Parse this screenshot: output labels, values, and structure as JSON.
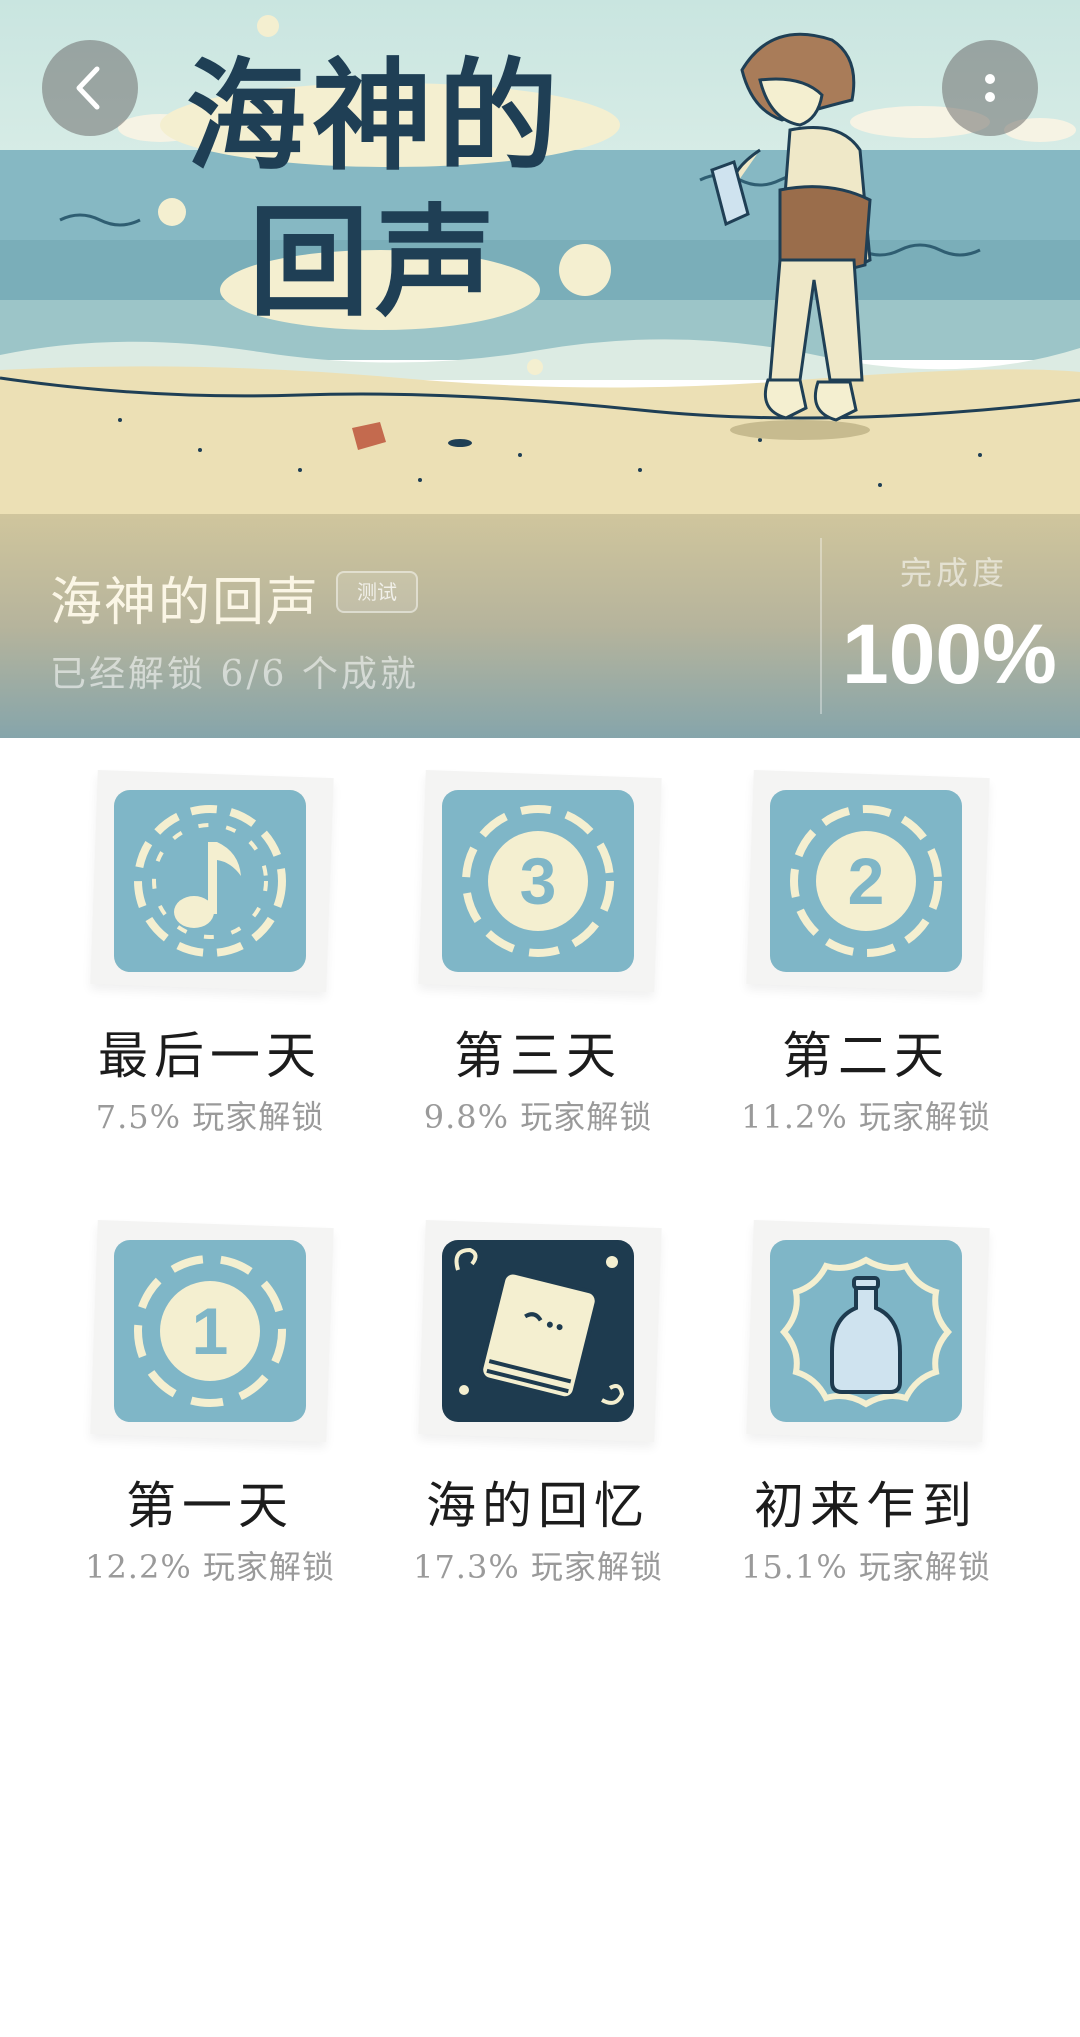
{
  "hero": {
    "title_art_line1": "海神的",
    "title_art_line2": "回声",
    "game_name": "海神的回声",
    "badge": "测试",
    "unlock_text": "已经解锁 6/6 个成就",
    "completion_label": "完成度",
    "completion_value": "100%"
  },
  "achievements": [
    {
      "name": "最后一天",
      "rate": "7.5% 玩家解锁",
      "icon": "music-note-icon"
    },
    {
      "name": "第三天",
      "rate": "9.8% 玩家解锁",
      "icon": "number-3-icon"
    },
    {
      "name": "第二天",
      "rate": "11.2% 玩家解锁",
      "icon": "number-2-icon"
    },
    {
      "name": "第一天",
      "rate": "12.2% 玩家解锁",
      "icon": "number-1-icon"
    },
    {
      "name": "海的回忆",
      "rate": "17.3% 玩家解锁",
      "icon": "book-icon"
    },
    {
      "name": "初来乍到",
      "rate": "15.1% 玩家解锁",
      "icon": "bottle-icon"
    }
  ],
  "colors": {
    "sea_light": "#bfe0df",
    "sea_mid": "#79acb8",
    "sand": "#ece0b5",
    "tile_blue": "#7fb6c7",
    "tile_dark": "#1e3b4f",
    "cream": "#f4efd0",
    "title_ink": "#1f3f55"
  }
}
